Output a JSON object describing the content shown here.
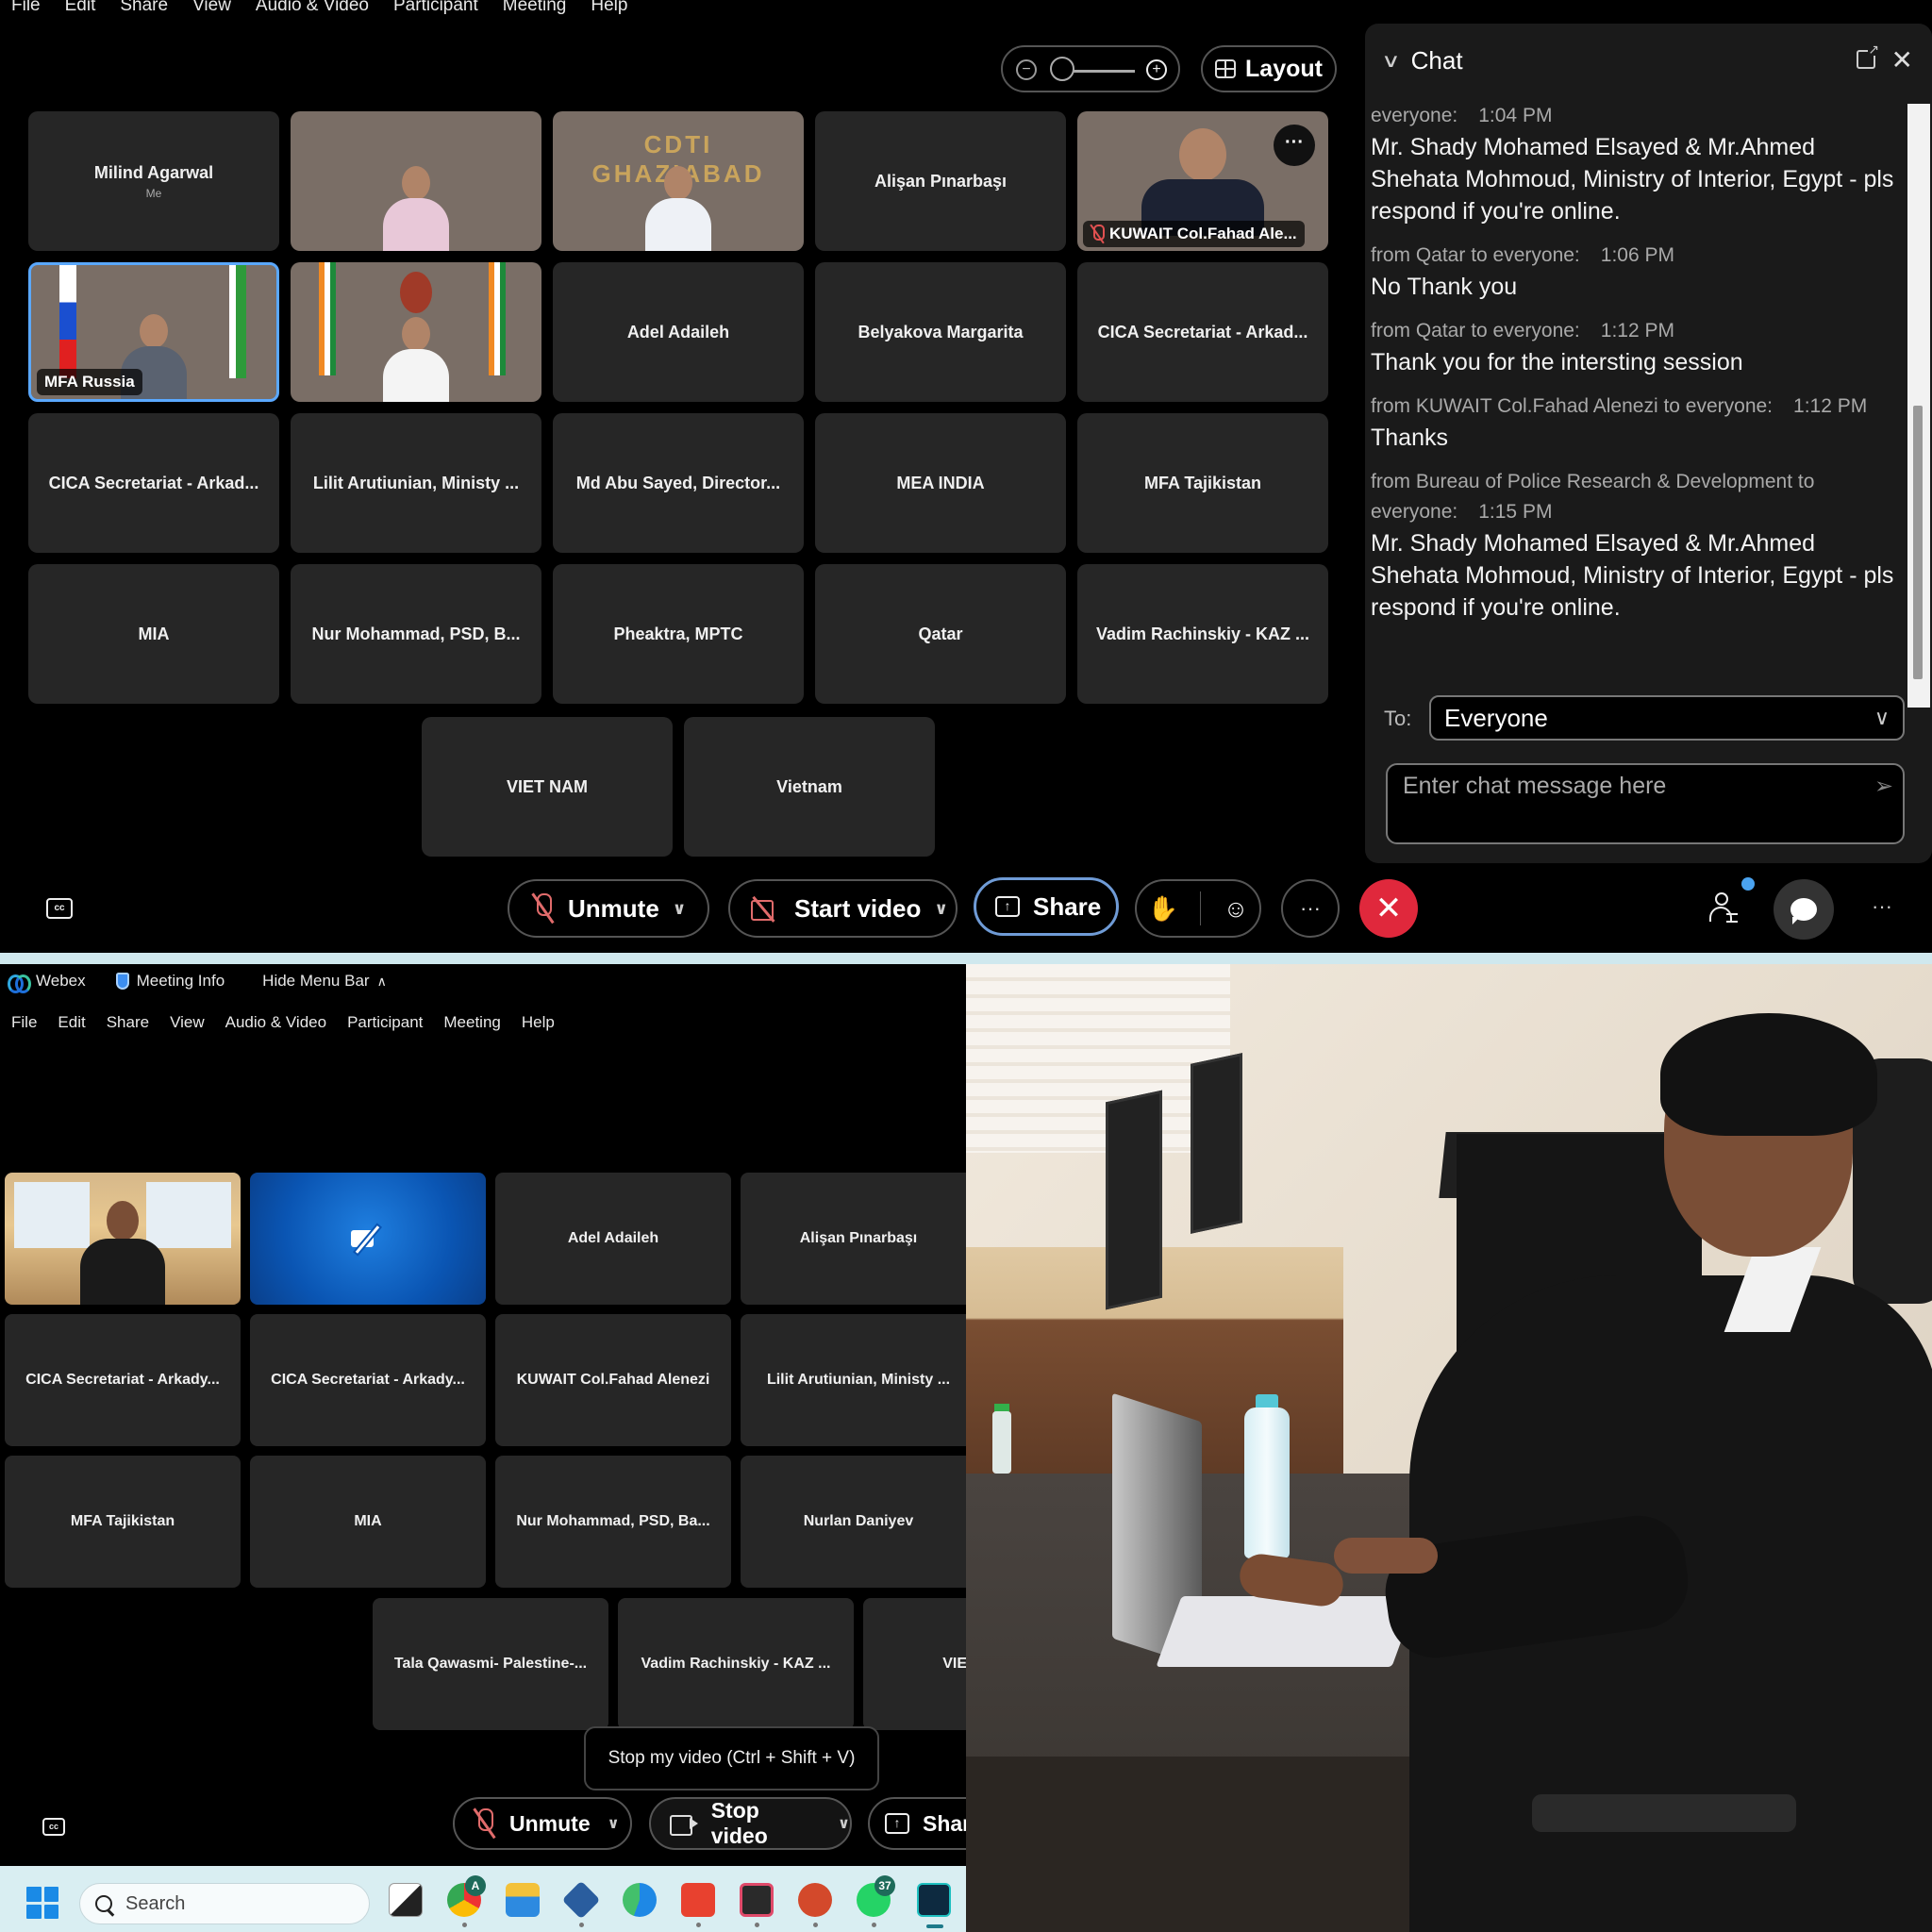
{
  "top_window": {
    "menu": [
      "File",
      "Edit",
      "Share",
      "View",
      "Audio & Video",
      "Participant",
      "Meeting",
      "Help"
    ],
    "layout_label": "Layout",
    "tiles": [
      {
        "name": "Milind Agarwal",
        "sub": "Me",
        "video": false
      },
      {
        "name": "",
        "video": true
      },
      {
        "name": "",
        "video": true
      },
      {
        "name": "Alişan Pınarbaşı",
        "video": false
      },
      {
        "name": "KUWAIT Col.Fahad Ale...",
        "video": true,
        "muted": true
      },
      {
        "name": "MFA Russia",
        "video": true
      },
      {
        "name": "",
        "video": true
      },
      {
        "name": "Adel Adaileh",
        "video": false
      },
      {
        "name": "Belyakova Margarita",
        "video": false
      },
      {
        "name": "CICA Secretariat - Arkad...",
        "video": false
      },
      {
        "name": "CICA Secretariat - Arkad...",
        "video": false
      },
      {
        "name": "Lilit Arutiunian, Ministy ...",
        "video": false
      },
      {
        "name": "Md Abu Sayed, Director...",
        "video": false
      },
      {
        "name": "MEA INDIA",
        "video": false
      },
      {
        "name": "MFA Tajikistan",
        "video": false
      },
      {
        "name": "MIA",
        "video": false
      },
      {
        "name": "Nur Mohammad, PSD, B...",
        "video": false
      },
      {
        "name": "Pheaktra, MPTC",
        "video": false
      },
      {
        "name": "Qatar",
        "video": false
      },
      {
        "name": "Vadim Rachinskiy - KAZ ...",
        "video": false
      },
      {
        "name": "VIET NAM",
        "video": false
      },
      {
        "name": "Vietnam",
        "video": false
      }
    ],
    "controls": {
      "unmute": "Unmute",
      "start_video": "Start video",
      "share": "Share",
      "more": "···"
    },
    "chat": {
      "title": "Chat",
      "messages": [
        {
          "meta": "everyone:",
          "time": "1:04 PM",
          "body": "Mr. Shady Mohamed Elsayed & Mr.Ahmed Shehata Mohmoud, Ministry of Interior, Egypt - pls respond if you're online."
        },
        {
          "meta": "from Qatar to everyone:",
          "time": "1:06 PM",
          "body": "No Thank you"
        },
        {
          "meta": "from Qatar to everyone:",
          "time": "1:12 PM",
          "body": "Thank you for the intersting session"
        },
        {
          "meta": "from KUWAIT Col.Fahad Alenezi to everyone:",
          "time": "1:12 PM",
          "body": "Thanks"
        },
        {
          "meta": "from Bureau of Police Research & Development to everyone:",
          "time": "1:15 PM",
          "body": "Mr. Shady Mohamed Elsayed & Mr.Ahmed Shehata Mohmoud, Ministry of Interior, Egypt - pls respond if you're online."
        }
      ],
      "to_label": "To:",
      "to_value": "Everyone",
      "input_placeholder": "Enter chat message here"
    }
  },
  "bottom_window": {
    "titlebar": {
      "app": "Webex",
      "meeting_info": "Meeting Info",
      "hide_menu": "Hide Menu Bar"
    },
    "menu": [
      "File",
      "Edit",
      "Share",
      "View",
      "Audio & Video",
      "Participant",
      "Meeting",
      "Help"
    ],
    "tiles": [
      {
        "name": "",
        "video": true
      },
      {
        "name": "",
        "video_off": true
      },
      {
        "name": "Adel Adaileh"
      },
      {
        "name": "Alişan Pınarbaşı"
      },
      {
        "name": "CICA Secretariat - Arkady..."
      },
      {
        "name": "CICA Secretariat - Arkady..."
      },
      {
        "name": "KUWAIT Col.Fahad Alenezi"
      },
      {
        "name": "Lilit Arutiunian, Ministy ..."
      },
      {
        "name": "MFA Tajikistan"
      },
      {
        "name": "MIA"
      },
      {
        "name": "Nur Mohammad, PSD, Ba..."
      },
      {
        "name": "Nurlan Daniyev"
      },
      {
        "name": "Tala Qawasmi- Palestine-..."
      },
      {
        "name": "Vadim Rachinskiy - KAZ ..."
      },
      {
        "name": "VIE"
      }
    ],
    "tooltip": "Stop my video (Ctrl + Shift + V)",
    "controls": {
      "unmute": "Unmute",
      "stop_video": "Stop video",
      "share": "Shar"
    },
    "taskbar": {
      "search_placeholder": "Search",
      "apps": [
        "task-view",
        "chrome",
        "file-explorer",
        "virtualbox",
        "edge",
        "anydesk",
        "app-64",
        "powerpoint",
        "whatsapp",
        "webex"
      ],
      "chrome_badge": "A",
      "whatsapp_badge": "37"
    }
  },
  "photo": {
    "description": "Man in black suit typing on a laptop at a conference desk"
  }
}
